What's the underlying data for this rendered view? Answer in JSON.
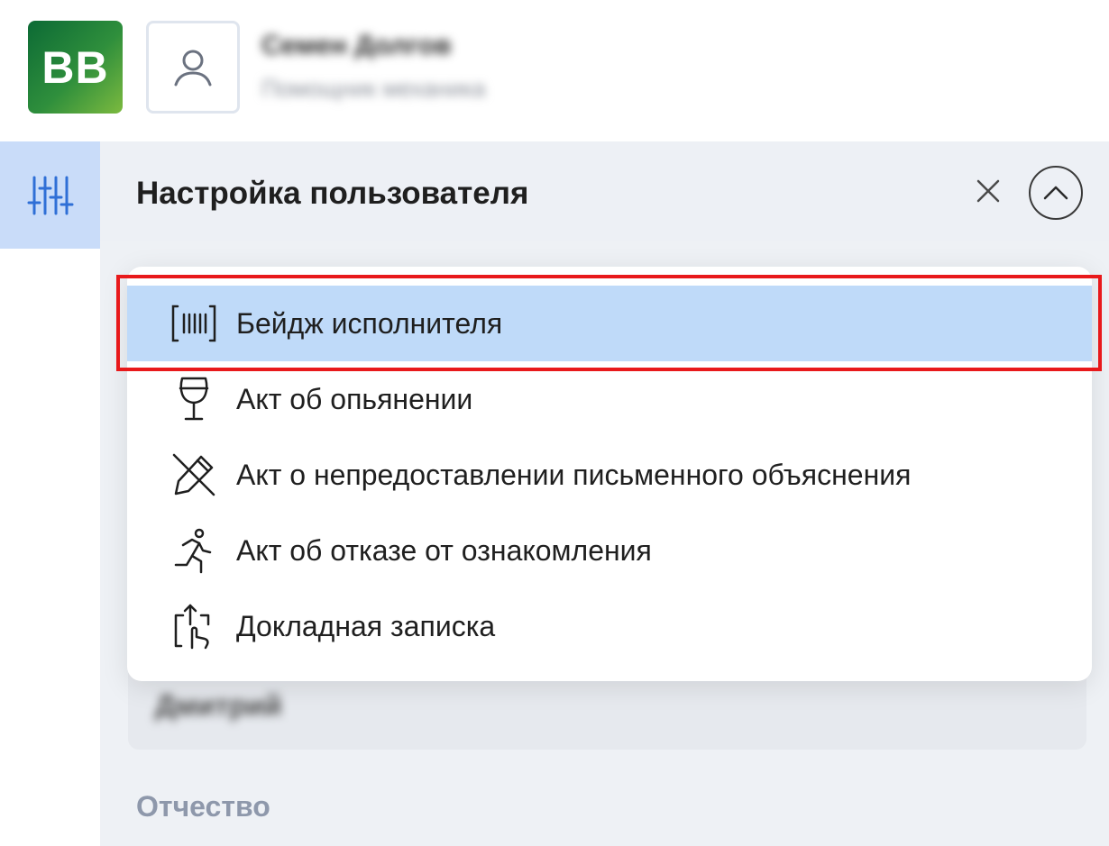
{
  "header": {
    "logo_text": "BB",
    "user_name": "Семен Долгов",
    "user_role": "Помощник механика"
  },
  "rail": {
    "active_icon": "sliders-icon"
  },
  "panel": {
    "title": "Настройка пользователя",
    "close_icon": "close-icon",
    "collapse_icon": "chevron-up-icon",
    "field_value": "Дмитрий",
    "next_field_label": "Отчество"
  },
  "menu": {
    "items": [
      {
        "label": "Бейдж исполнителя",
        "icon": "barcode-icon",
        "selected": true
      },
      {
        "label": "Акт об опьянении",
        "icon": "wine-glass-icon",
        "selected": false
      },
      {
        "label": "Акт о непредоставлении письменного объяснения",
        "icon": "pen-off-icon",
        "selected": false
      },
      {
        "label": "Акт об отказе от ознакомления",
        "icon": "running-person-icon",
        "selected": false
      },
      {
        "label": "Докладная записка",
        "icon": "hand-upload-icon",
        "selected": false
      }
    ]
  },
  "colors": {
    "selected_bg": "#bfdaf9",
    "highlight": "#e8191b",
    "logo_green": "#2f8f3c"
  }
}
